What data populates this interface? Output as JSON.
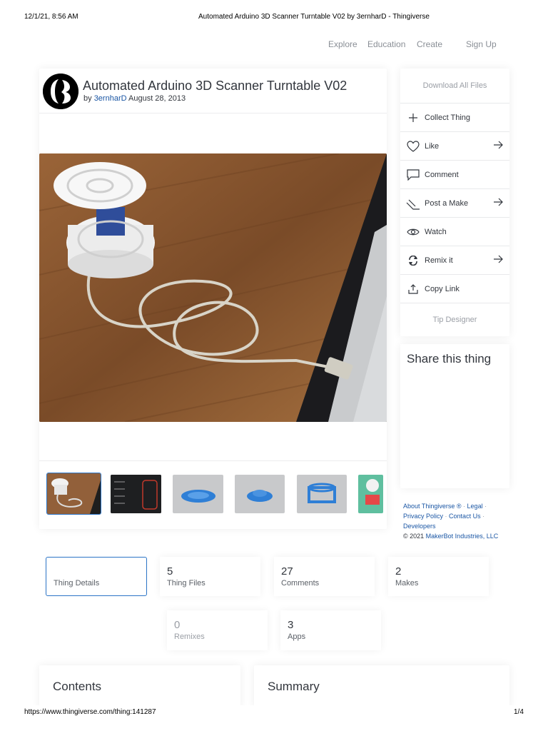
{
  "print": {
    "datetime": "12/1/21, 8:56 AM",
    "doc_title": "Automated Arduino 3D Scanner Turntable V02 by 3ernharD - Thingiverse",
    "url": "https://www.thingiverse.com/thing:141287",
    "page": "1/4"
  },
  "nav": {
    "explore": "Explore",
    "education": "Education",
    "create": "Create",
    "signup": "Sign Up"
  },
  "thing": {
    "title": "Automated Arduino 3D Scanner Turntable V02",
    "by": "by",
    "author": "3ernharD",
    "date": "August 28, 2013"
  },
  "sidebar": {
    "download": "Download All Files",
    "collect": "Collect Thing",
    "like": "Like",
    "comment": "Comment",
    "post_make": "Post a Make",
    "watch": "Watch",
    "remix": "Remix it",
    "copy_link": "Copy Link",
    "tip": "Tip Designer"
  },
  "share": {
    "title": "Share this thing"
  },
  "about": {
    "about": "About Thingiverse ®",
    "legal": "Legal",
    "privacy": "Privacy Policy",
    "contact": "Contact Us",
    "developers": "Developers",
    "copyright": "© 2021",
    "company": "MakerBot Industries, LLC",
    "dot": "·"
  },
  "stats": {
    "details": {
      "label": "Thing Details"
    },
    "files": {
      "num": "5",
      "label": "Thing Files"
    },
    "comments": {
      "num": "27",
      "label": "Comments"
    },
    "makes": {
      "num": "2",
      "label": "Makes"
    },
    "remixes": {
      "num": "0",
      "label": "Remixes"
    },
    "apps": {
      "num": "3",
      "label": "Apps"
    }
  },
  "sections": {
    "contents": "Contents",
    "summary": "Summary"
  }
}
